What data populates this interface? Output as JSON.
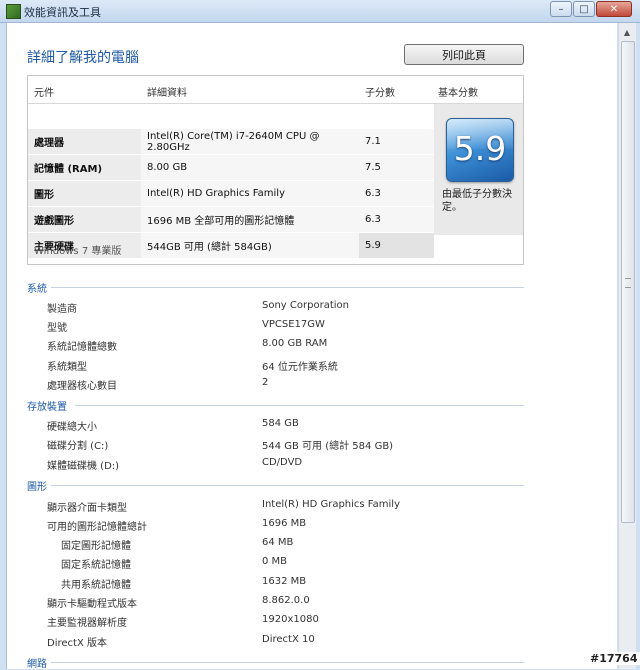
{
  "window": {
    "title": "效能資訊及工具",
    "min_label": "–",
    "max_label": "□",
    "close_label": "✕"
  },
  "page": {
    "heading": "詳細了解我的電腦",
    "print_button": "列印此頁"
  },
  "score_table": {
    "headers": {
      "component": "元件",
      "detail": "詳細資料",
      "subscore": "子分數",
      "base": "基本分數"
    },
    "rows": [
      {
        "component": "處理器",
        "detail": "Intel(R) Core(TM) i7-2640M CPU @ 2.80GHz",
        "subscore": "7.1"
      },
      {
        "component": "記憶體 (RAM)",
        "detail": "8.00 GB",
        "subscore": "7.5"
      },
      {
        "component": "圖形",
        "detail": "Intel(R) HD Graphics Family",
        "subscore": "6.3"
      },
      {
        "component": "遊戲圖形",
        "detail": "1696 MB 全部可用的圖形記憶體",
        "subscore": "6.3"
      },
      {
        "component": "主要硬碟",
        "detail": "544GB 可用 (總計 584GB)",
        "subscore": "5.9"
      }
    ],
    "base_score": "5.9",
    "base_caption": "由最低子分數決定。",
    "edition": "Windows 7 專業版"
  },
  "sections": [
    {
      "title": "系統",
      "items": [
        {
          "label": "製造商",
          "value": "Sony Corporation"
        },
        {
          "label": "型號",
          "value": "VPCSE17GW"
        },
        {
          "label": "系統記憶體總數",
          "value": "8.00 GB RAM"
        },
        {
          "label": "系統類型",
          "value": "64 位元作業系統"
        },
        {
          "label": "處理器核心數目",
          "value": "2"
        }
      ]
    },
    {
      "title": "存放裝置",
      "items": [
        {
          "label": "硬碟總大小",
          "value": "584 GB"
        },
        {
          "label": "磁碟分割 (C:)",
          "value": "544 GB 可用 (總計 584 GB)"
        },
        {
          "label": "媒體磁碟機 (D:)",
          "value": "CD/DVD"
        }
      ]
    },
    {
      "title": "圖形",
      "items": [
        {
          "label": "顯示器介面卡類型",
          "value": "Intel(R) HD Graphics Family"
        },
        {
          "label": "可用的圖形記憶體總計",
          "value": "1696 MB"
        },
        {
          "label": "固定圖形記憶體",
          "value": "64 MB"
        },
        {
          "label": "固定系統記憶體",
          "value": "0 MB"
        },
        {
          "label": "共用系統記憶體",
          "value": "1632 MB"
        },
        {
          "label": "顯示卡驅動程式版本",
          "value": "8.862.0.0"
        },
        {
          "label": "主要監視器解析度",
          "value": "1920x1080"
        },
        {
          "label": "DirectX 版本",
          "value": "DirectX 10"
        }
      ]
    },
    {
      "title": "網路",
      "items": []
    }
  ],
  "watermark": "#17764",
  "colors": {
    "accent": "#1e5aa8",
    "badge": "#3d8fd6"
  },
  "icons": {
    "app": "performance-icon",
    "scroll_up": "chevron-up-icon",
    "scroll_down": "chevron-down-icon"
  }
}
